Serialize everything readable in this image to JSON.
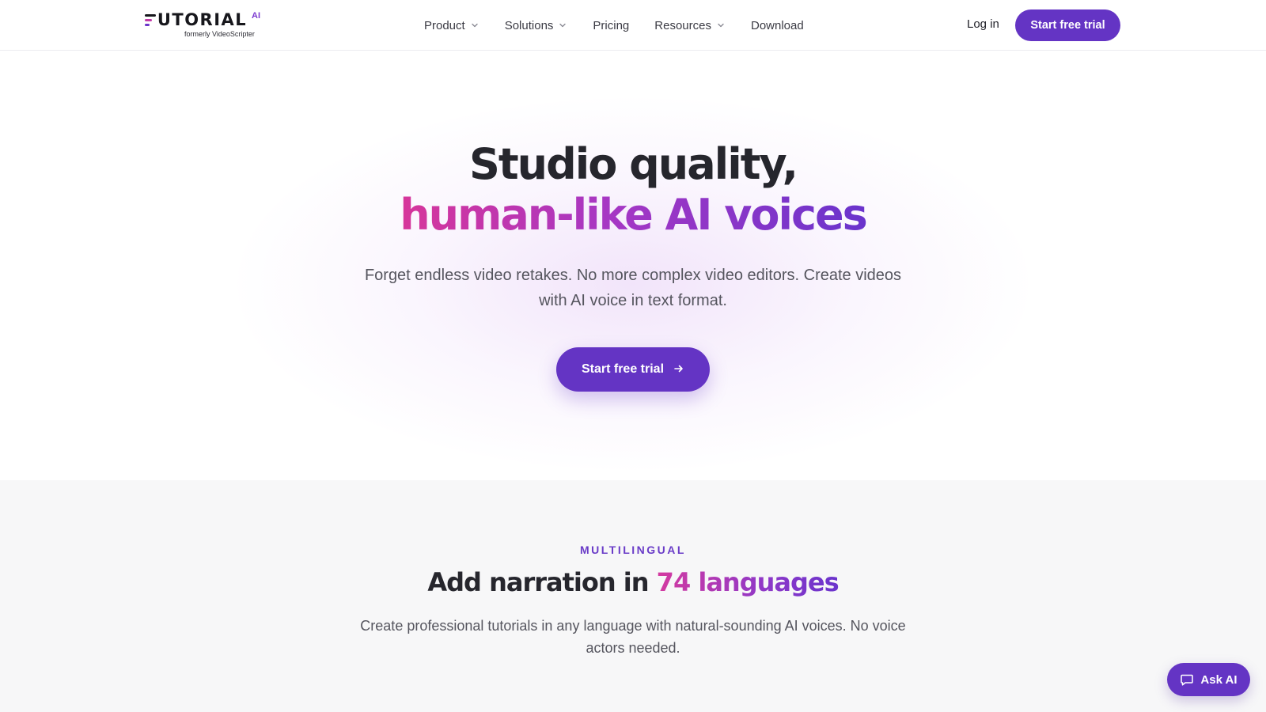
{
  "brand": {
    "logo_text": "TUTORIAL",
    "logo_suffix": "AI",
    "tagline": "formerly VideoScripter"
  },
  "nav": {
    "items": [
      {
        "label": "Product",
        "dropdown": true
      },
      {
        "label": "Solutions",
        "dropdown": true
      },
      {
        "label": "Pricing",
        "dropdown": false
      },
      {
        "label": "Resources",
        "dropdown": true
      },
      {
        "label": "Download",
        "dropdown": false
      }
    ],
    "login_label": "Log in",
    "cta_label": "Start free trial"
  },
  "hero": {
    "title_line1": "Studio quality,",
    "title_line2": "human-like AI voices",
    "subtitle": "Forget endless video retakes. No more complex video editors. Create videos with AI voice in text format.",
    "cta_label": "Start free trial",
    "cta_icon": "arrow-right-icon"
  },
  "multilingual": {
    "eyebrow": "MULTILINGUAL",
    "title_prefix": "Add narration in ",
    "title_highlight": "74 languages",
    "subtitle": "Create professional tutorials in any language with natural-sounding AI voices. No voice actors needed."
  },
  "ask_ai": {
    "label": "Ask AI",
    "icon": "chat-bubble-icon"
  },
  "colors": {
    "primary": "#6434c4",
    "gradient_start": "#d7369a",
    "gradient_end": "#6a34cc",
    "section_bg": "#f7f7f8"
  }
}
